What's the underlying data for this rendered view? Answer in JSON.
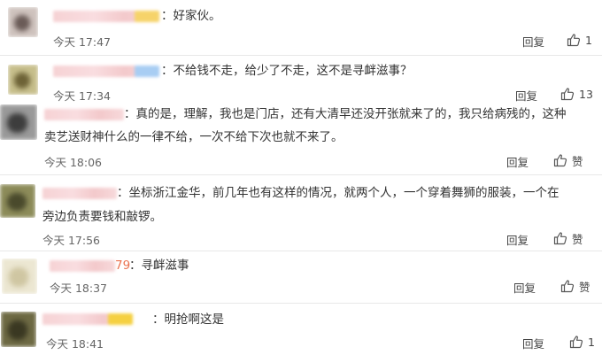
{
  "reply_label": "回复",
  "comments": [
    {
      "text": "：好家伙。",
      "time": "今天 17:47",
      "likes": "1",
      "avatar_colors": [
        "#6a5b57",
        "#d7c7c2"
      ],
      "name_accent": "#f6d36a"
    },
    {
      "text": "：不给钱不走，给少了不走，这不是寻衅滋事？",
      "time": "今天 17:34",
      "likes": "13",
      "avatar_colors": [
        "#b9b07a",
        "#6d6236"
      ],
      "name_accent": "#a8cdf3"
    },
    {
      "text_line1": "：真的是，理解，我也是门店，还有大清早还没开张就来了的，我只给病残的，这种",
      "text_line2": "卖艺送财神什么的一律不给，一次不给下次也就不来了。",
      "time": "今天 18:06",
      "likes": "赞",
      "avatar_colors": [
        "#8c8c8c",
        "#3d3d3d"
      ]
    },
    {
      "text_line1": "：坐标浙江金华，前几年也有这样的情况，就两个人，一个穿着舞狮的服装，一个在",
      "text_line2": "旁边负责要钱和敲锣。",
      "time": "今天 17:56",
      "likes": "赞",
      "avatar_colors": [
        "#5a5a36",
        "#8d8c5a"
      ]
    },
    {
      "name_suffix": "79",
      "text": "：寻衅滋事",
      "time": "今天 18:37",
      "likes": "赞",
      "avatar_colors": [
        "#e8e2c9",
        "#cfc6a2"
      ]
    },
    {
      "text": "：明抢啊这是",
      "time": "今天 18:41",
      "likes": "1",
      "avatar_colors": [
        "#7a7247",
        "#3a3822"
      ],
      "name_accent": "#f5d040"
    }
  ]
}
